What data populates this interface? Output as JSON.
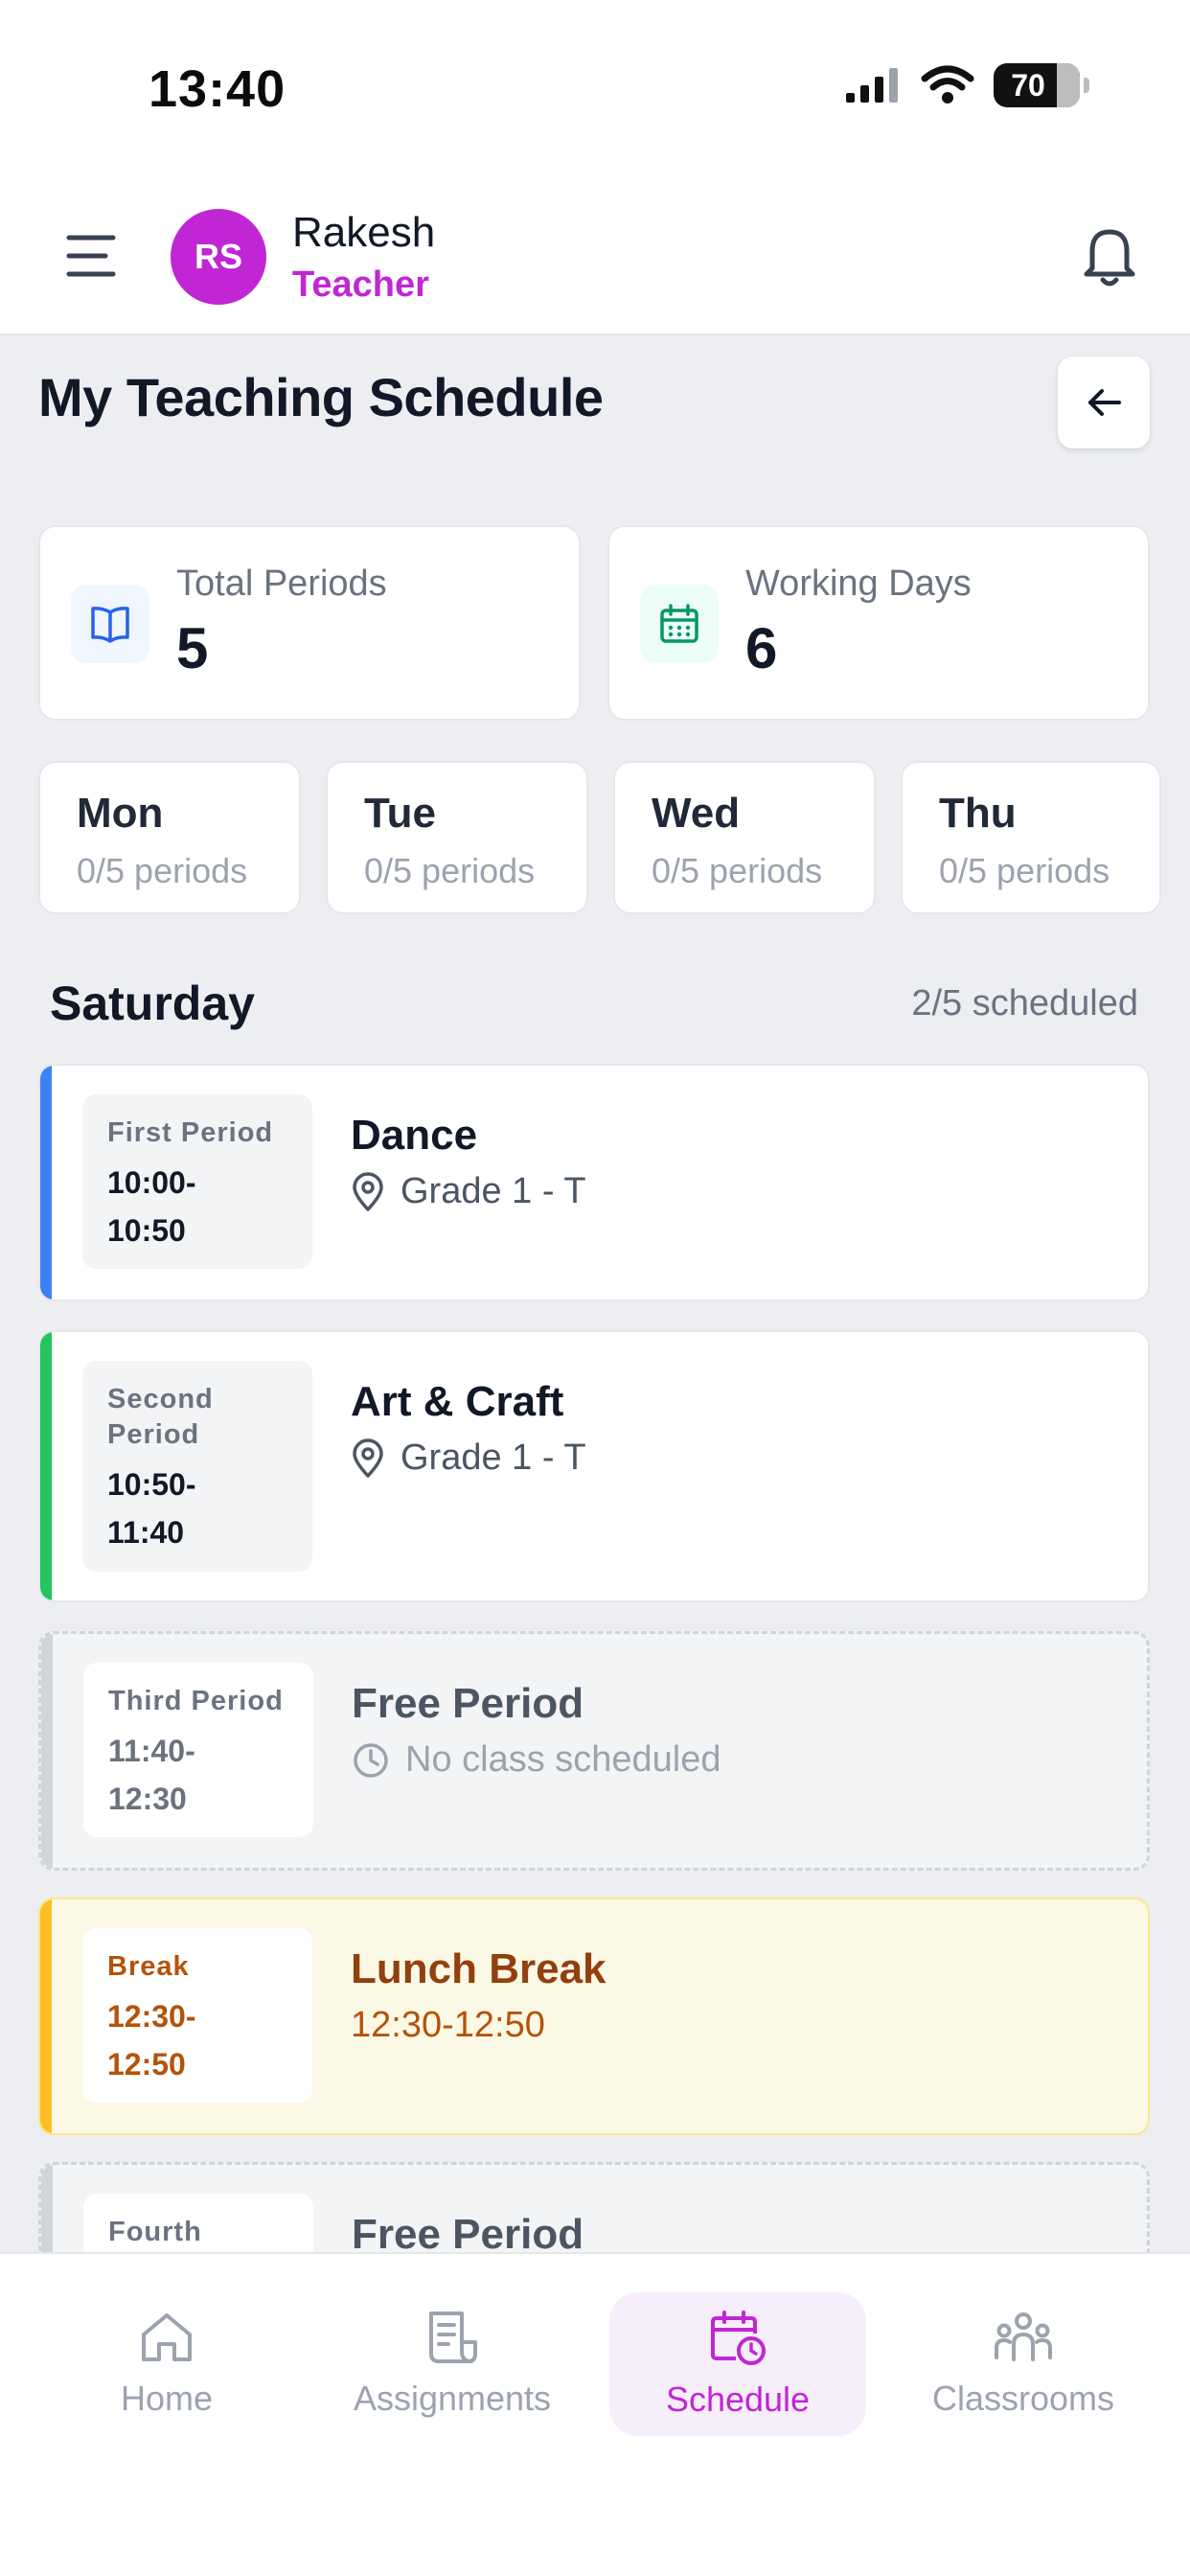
{
  "status_bar": {
    "time": "13:40",
    "battery": "70"
  },
  "header": {
    "avatar_initials": "RS",
    "user_name": "Rakesh",
    "user_role": "Teacher"
  },
  "page": {
    "title": "My Teaching Schedule"
  },
  "stats": [
    {
      "label": "Total Periods",
      "value": "5",
      "icon": "book-icon"
    },
    {
      "label": "Working Days",
      "value": "6",
      "icon": "calendar-icon"
    }
  ],
  "days": [
    {
      "name": "Mon",
      "periods": "0/5 periods"
    },
    {
      "name": "Tue",
      "periods": "0/5 periods"
    },
    {
      "name": "Wed",
      "periods": "0/5 periods"
    },
    {
      "name": "Thu",
      "periods": "0/5 periods"
    }
  ],
  "section": {
    "day": "Saturday",
    "count": "2/5 scheduled"
  },
  "periods": [
    {
      "label": "First Period",
      "time_start": "10:00-",
      "time_end": "10:50",
      "subject": "Dance",
      "detail": "Grade 1 - T",
      "type": "class"
    },
    {
      "label": "Second Period",
      "time_start": "10:50-",
      "time_end": "11:40",
      "subject": "Art & Craft",
      "detail": "Grade 1 - T",
      "type": "class"
    },
    {
      "label": "Third Period",
      "time_start": "11:40-",
      "time_end": "12:30",
      "subject": "Free Period",
      "detail": "No class scheduled",
      "type": "free"
    },
    {
      "label": "Break",
      "time_start": "12:30-",
      "time_end": "12:50",
      "subject": "Lunch Break",
      "detail": "12:30-12:50",
      "type": "break"
    },
    {
      "label": "Fourth",
      "subject": "Free Period",
      "type": "free"
    }
  ],
  "nav": [
    {
      "label": "Home",
      "icon": "home-icon"
    },
    {
      "label": "Assignments",
      "icon": "assignments-icon"
    },
    {
      "label": "Schedule",
      "icon": "schedule-icon",
      "active": true
    },
    {
      "label": "Classrooms",
      "icon": "classrooms-icon"
    }
  ],
  "colors": {
    "accent": "#c026d3",
    "blue": "#3b82f6",
    "green": "#22c55e",
    "amber": "#f59e0b",
    "gray": "#d1d5db"
  }
}
